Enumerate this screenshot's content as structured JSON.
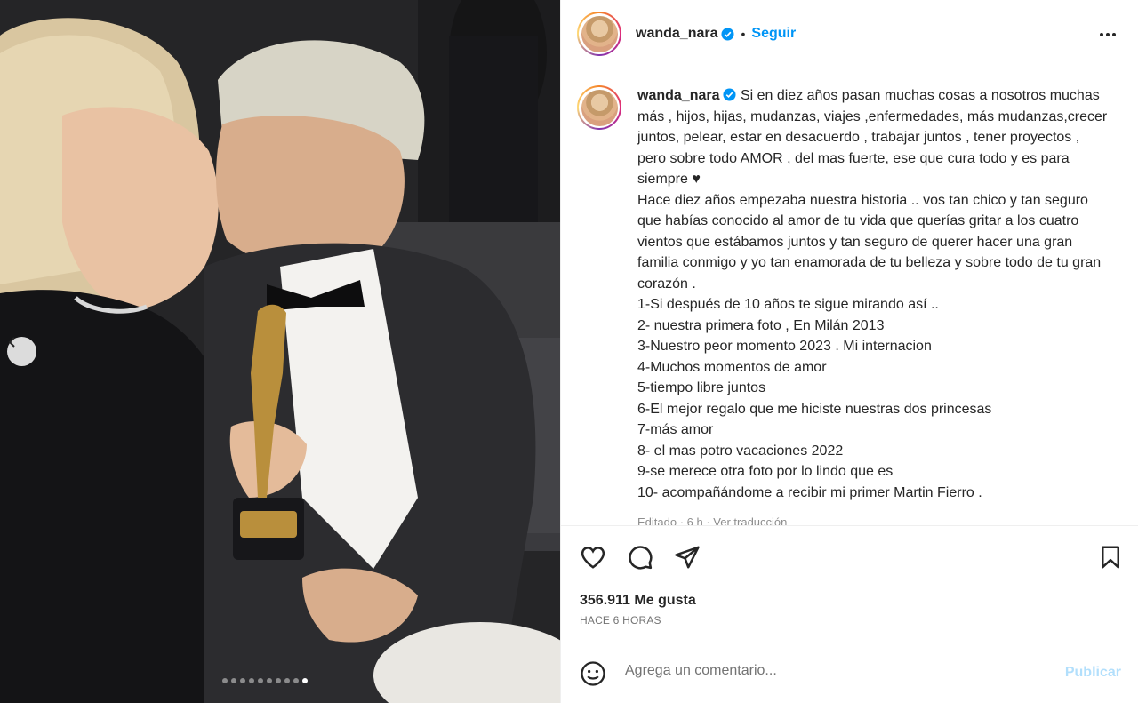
{
  "post": {
    "image_description_icon": "photo",
    "carousel": {
      "total_slides": 10,
      "current_slide": 10
    }
  },
  "header": {
    "username": "wanda_nara",
    "separator": "•",
    "follow_label": "Seguir"
  },
  "caption": {
    "username": "wanda_nara",
    "lines": [
      "Si en diez años pasan muchas cosas a nosotros muchas más , hijos, hijas, mudanzas, viajes ,enfermedades, más mudanzas,crecer juntos, pelear, estar en desacuerdo , trabajar juntos , tener proyectos , pero sobre todo AMOR , del mas fuerte, ese que cura todo y es para siempre ♥",
      "Hace diez años empezaba nuestra historia .. vos tan chico y tan seguro que habías conocido al amor de tu vida que querías gritar a los cuatro vientos que estábamos juntos y tan seguro de querer hacer una gran familia conmigo y yo tan enamorada de tu belleza y sobre todo de tu gran corazón .",
      "1-Si después de 10 años te sigue mirando así ..",
      "2- nuestra primera foto , En Milán 2013",
      "3-Nuestro peor momento 2023 . Mi internacion",
      "4-Muchos momentos de amor",
      "5-tiempo libre juntos",
      "6-El mejor regalo que me hiciste nuestras dos princesas",
      "7-más amor",
      "8- el mas potro vacaciones 2022",
      "9-se merece otra foto por lo lindo que es",
      "10- acompañándome a recibir mi primer Martin Fierro ."
    ],
    "edited_text": "Editado · 6 h · Ver traducción"
  },
  "actions": {
    "like_icon": "heart-icon",
    "comment_icon": "comment-icon",
    "share_icon": "send-icon",
    "save_icon": "bookmark-icon"
  },
  "stats": {
    "likes": "356.911 Me gusta",
    "time_ago": "HACE 6 HORAS"
  },
  "comment": {
    "placeholder": "Agrega un comentario...",
    "publish_label": "Publicar"
  },
  "colors": {
    "accent": "#0095f6",
    "publish_disabled": "#b2dffc",
    "text": "#262626",
    "muted": "#737373"
  }
}
